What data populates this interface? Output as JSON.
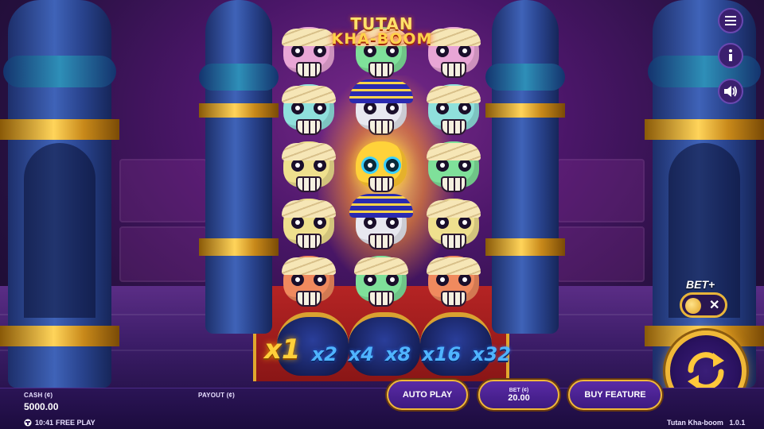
{
  "game": {
    "title_line1": "TUTAN",
    "title_line2": "KHA-BOOM",
    "name_version": "Tutan Kha-boom   1.0.1"
  },
  "reels": [
    [
      "pink-mummy-skull",
      "teal-mummy-skull",
      "yellow-mummy-skull",
      "yellow-mummy-skull",
      "orange-mummy-skull"
    ],
    [
      "green-mummy-skull",
      "pharaoh-skull",
      "golden-skull",
      "pharaoh-skull",
      "green-mummy-skull"
    ],
    [
      "pink-mummy-skull",
      "teal-mummy-skull",
      "green-mummy-skull",
      "yellow-mummy-skull",
      "orange-mummy-skull"
    ]
  ],
  "multipliers": [
    "x1",
    "x2",
    "x4",
    "x8",
    "x16",
    "x32"
  ],
  "active_multiplier": "x1",
  "controls": {
    "menu_icon": "menu-icon",
    "info_icon": "info-icon",
    "sound_icon": "speaker-icon",
    "betplus_label": "BET+",
    "betplus_off_symbol": "✕",
    "spin_icon": "spin-arrows-icon"
  },
  "bottom": {
    "cash_label": "CASH (¢)",
    "cash_value": "5000.00",
    "payout_label": "PAYOUT (¢)",
    "time": "10:41",
    "mode": "FREE PLAY",
    "autoplay_label": "AUTO PLAY",
    "bet_label": "BET (¢)",
    "bet_value": "20.00",
    "buy_feature_label": "BUY FEATURE"
  },
  "colors": {
    "accent_gold": "#f0b838",
    "button_purple": "#4a1f92",
    "multiplier_blue": "#4fb4ff",
    "multiplier_active": "#ffd03a"
  }
}
